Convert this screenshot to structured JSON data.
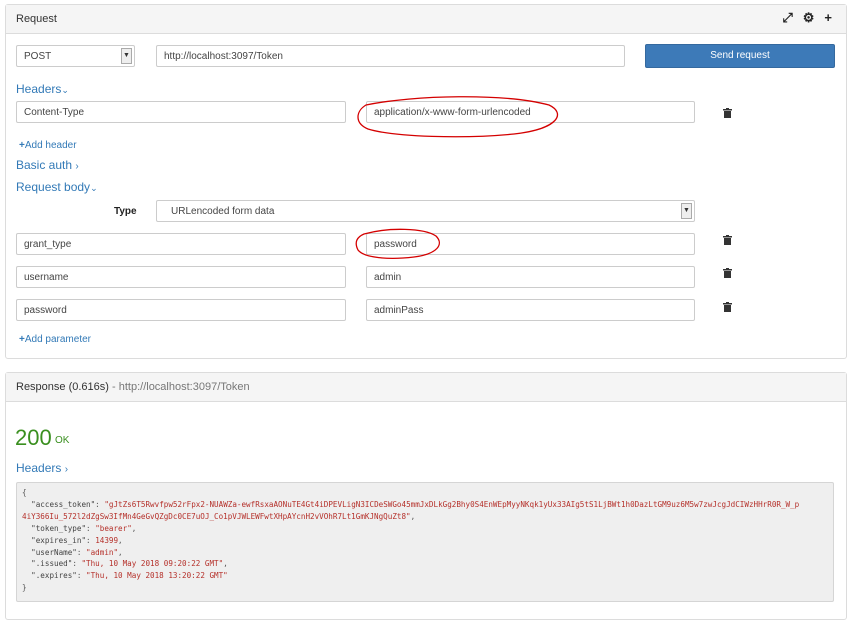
{
  "request": {
    "title": "Request",
    "method": "POST",
    "url": "http://localhost:3097/Token",
    "send_label": "Send request",
    "headers_label": "Headers",
    "headers": [
      {
        "name": "Content-Type",
        "value": "application/x-www-form-urlencoded"
      }
    ],
    "add_header_label": "Add header",
    "basic_auth_label": "Basic auth",
    "body_label": "Request body",
    "type_label": "Type",
    "type_value": "URLencoded form data",
    "params": [
      {
        "name": "grant_type",
        "value": "password"
      },
      {
        "name": "username",
        "value": "admin"
      },
      {
        "name": "password",
        "value": "adminPass"
      }
    ],
    "add_param_label": "Add parameter"
  },
  "response": {
    "title": "Response (0.616s)",
    "separator": " - ",
    "url": "http://localhost:3097/Token",
    "status_code": "200",
    "status_text": "OK",
    "headers_label": "Headers",
    "body": {
      "open": "{",
      "close": "}",
      "access_token_key": "\"access_token\"",
      "access_token_value_1": "\"gJtZs6T5Rwvfpw52rFpx2-NUAWZa-ewfRsxaAONuTE4Gt4iDPEVLigN3ICDeSWGo45mmJxDLkGg2Bhy0S4EnWEpMyyNKqk1yUx33AIg5tS1LjBWt1h0DazLtGM9uz6M5w7zwJcgJdCIWzHHrR0R_W_p",
      "access_token_value_2": "4iY366Iu_572l2dZgSw3IfMn4GeGvQZgDc0CE7uOJ_Co1pVJWLEWFwtXHpAYcnH2vVOhR7Lt1GmKJNgQuZt8\"",
      "token_type_key": "\"token_type\"",
      "token_type_value": "\"bearer\"",
      "expires_in_key": "\"expires_in\"",
      "expires_in_value": "14399",
      "userName_key": "\"userName\"",
      "userName_value": "\"admin\"",
      "issued_key": "\".issued\"",
      "issued_value": "\"Thu, 10 May 2018 09:20:22 GMT\"",
      "expires_key": "\".expires\"",
      "expires_value": "\"Thu, 10 May 2018 13:20:22 GMT\""
    }
  },
  "icons": {
    "expand": "expand-icon",
    "settings": "gear-icon",
    "add": "plus-icon",
    "delete": "trash-icon"
  },
  "colors": {
    "accent": "#337ab7",
    "button": "#3d7ab8",
    "success": "#3a8f1f",
    "annotation": "#d40000",
    "json_string": "#b5302a"
  }
}
